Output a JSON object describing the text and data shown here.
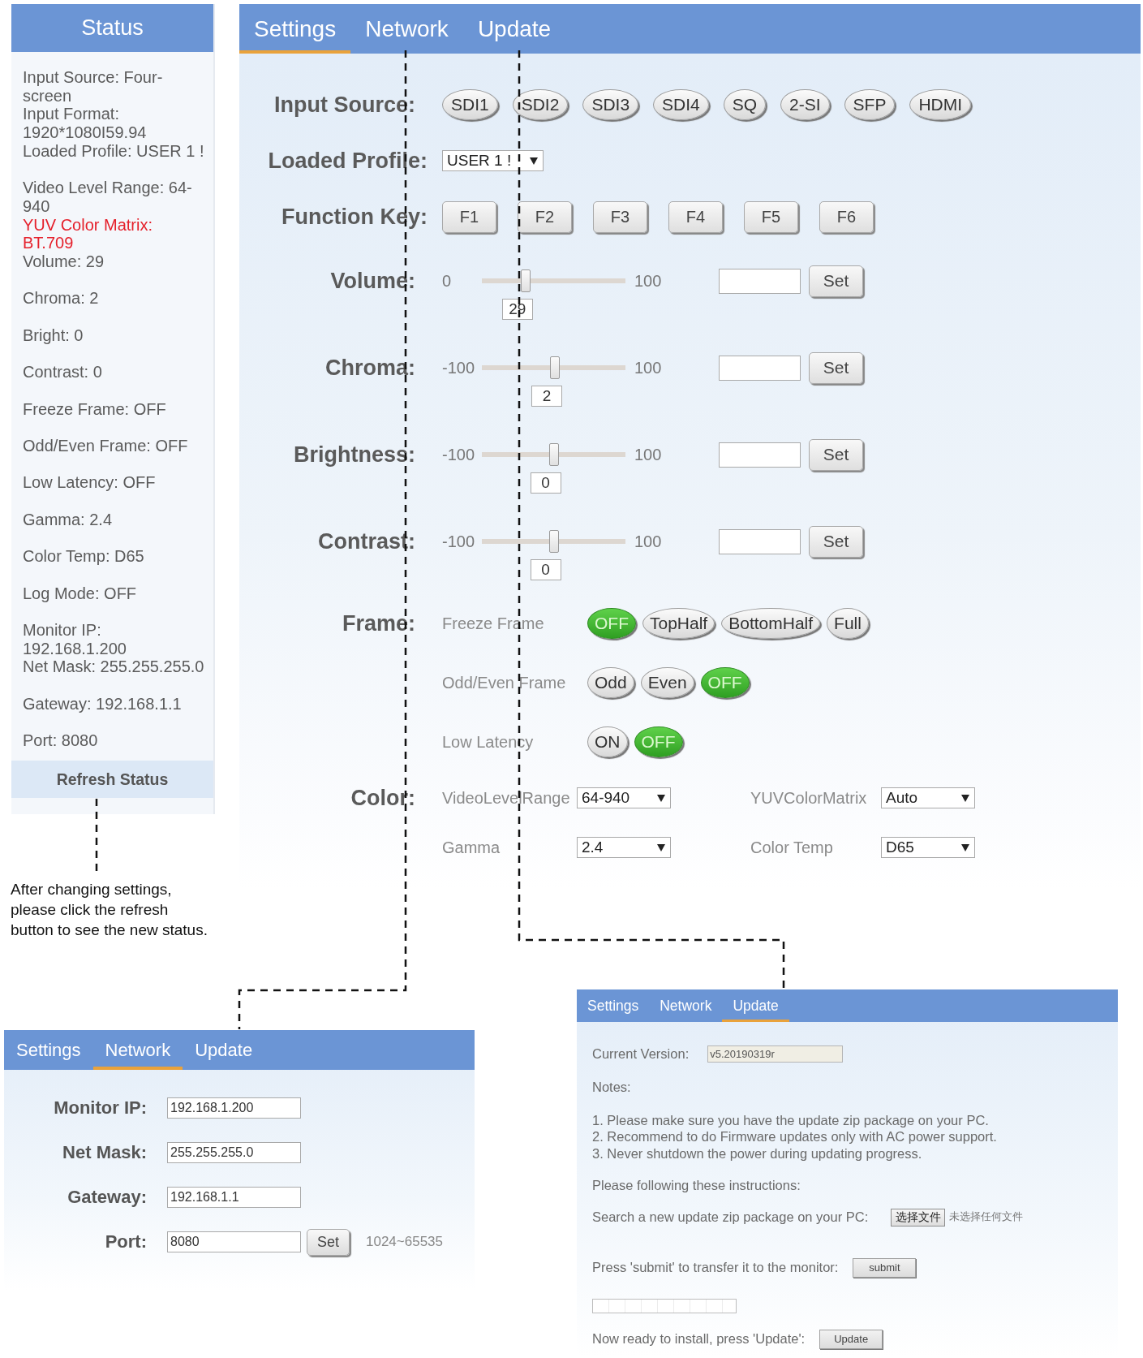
{
  "status_panel": {
    "title": "Status",
    "groups": [
      {
        "lines": [
          {
            "text": "Input Source: Four-screen",
            "highlighted": false
          },
          {
            "text": "Input Format: 1920*1080I59.94",
            "highlighted": false
          },
          {
            "text": "Loaded Profile: USER 1 !",
            "highlighted": false
          }
        ]
      },
      {
        "lines": [
          {
            "text": "Video Level Range: 64-940",
            "highlighted": false
          },
          {
            "text": "YUV Color Matrix: BT.709",
            "highlighted": true
          },
          {
            "text": "Volume: 29",
            "highlighted": false
          }
        ]
      },
      {
        "lines": [
          {
            "text": "Chroma: 2",
            "highlighted": false
          }
        ]
      },
      {
        "lines": [
          {
            "text": "Bright: 0",
            "highlighted": false
          }
        ]
      },
      {
        "lines": [
          {
            "text": "Contrast: 0",
            "highlighted": false
          }
        ]
      },
      {
        "lines": [
          {
            "text": "Freeze Frame: OFF",
            "highlighted": false
          }
        ]
      },
      {
        "lines": [
          {
            "text": "Odd/Even Frame: OFF",
            "highlighted": false
          }
        ]
      },
      {
        "lines": [
          {
            "text": "Low Latency: OFF",
            "highlighted": false
          }
        ]
      },
      {
        "lines": [
          {
            "text": "Gamma: 2.4",
            "highlighted": false
          }
        ]
      },
      {
        "lines": [
          {
            "text": "Color Temp: D65",
            "highlighted": false
          }
        ]
      },
      {
        "lines": [
          {
            "text": "Log Mode: OFF",
            "highlighted": false
          }
        ]
      },
      {
        "lines": [
          {
            "text": "Monitor IP: 192.168.1.200",
            "highlighted": false
          },
          {
            "text": "Net Mask: 255.255.255.0",
            "highlighted": false
          }
        ]
      },
      {
        "lines": [
          {
            "text": "Gateway: 192.168.1.1",
            "highlighted": false
          }
        ]
      },
      {
        "lines": [
          {
            "text": "Port: 8080",
            "highlighted": false
          }
        ]
      }
    ],
    "refresh_button": "Refresh Status"
  },
  "settings_panel": {
    "tabs": [
      {
        "label": "Settings",
        "selected": true
      },
      {
        "label": "Network",
        "selected": false
      },
      {
        "label": "Update",
        "selected": false
      }
    ],
    "rows": [
      {
        "kind": "pills",
        "label": "Input Source:",
        "options": [
          {
            "label": "SDI1",
            "selected": false
          },
          {
            "label": "SDI2",
            "selected": false
          },
          {
            "label": "SDI3",
            "selected": false
          },
          {
            "label": "SDI4",
            "selected": false
          },
          {
            "label": "SQ",
            "selected": false
          },
          {
            "label": "2-SI",
            "selected": false
          },
          {
            "label": "SFP",
            "selected": false
          },
          {
            "label": "HDMI",
            "selected": false
          }
        ]
      },
      {
        "kind": "select",
        "label": "Loaded Profile:",
        "value": "USER 1 !"
      },
      {
        "kind": "keys",
        "label": "Function Key:",
        "keys": [
          "F1",
          "F2",
          "F3",
          "F4",
          "F5",
          "F6"
        ]
      },
      {
        "kind": "slider",
        "label": "Volume:",
        "min": "0",
        "max": "100",
        "level": 0.29,
        "reading": "29",
        "button": "Set"
      },
      {
        "kind": "slider",
        "label": "Chroma:",
        "min": "-100",
        "max": "100",
        "level": 0.51,
        "reading": "2",
        "button": "Set"
      },
      {
        "kind": "slider",
        "label": "Brightness:",
        "min": "-100",
        "max": "100",
        "level": 0.5,
        "reading": "0",
        "button": "Set"
      },
      {
        "kind": "slider",
        "label": "Contrast:",
        "min": "-100",
        "max": "100",
        "level": 0.5,
        "reading": "0",
        "button": "Set"
      },
      {
        "kind": "toggles",
        "label": "Frame:",
        "groups": [
          {
            "label": "Freeze Frame",
            "options": [
              {
                "label": "OFF",
                "selected": true
              },
              {
                "label": "TopHalf",
                "selected": false
              },
              {
                "label": "BottomHalf",
                "selected": false
              },
              {
                "label": "Full",
                "selected": false
              }
            ]
          },
          {
            "label": "Odd/Even Frame",
            "options": [
              {
                "label": "Odd",
                "selected": false
              },
              {
                "label": "Even",
                "selected": false
              },
              {
                "label": "OFF",
                "selected": true
              }
            ]
          },
          {
            "label": "Low Latency",
            "options": [
              {
                "label": "ON",
                "selected": false
              },
              {
                "label": "OFF",
                "selected": true
              }
            ]
          }
        ]
      },
      {
        "kind": "selects",
        "label": "Color:",
        "fields": [
          {
            "label": "VideoLevelRange",
            "value": "64-940"
          },
          {
            "label": "YUVColorMatrix",
            "value": "Auto"
          },
          {
            "label": "Gamma",
            "value": "2.4"
          },
          {
            "label": "Color Temp",
            "value": "D65"
          }
        ]
      }
    ]
  },
  "note": "After changing settings, please click the refresh button to see the new status.",
  "network_panel": {
    "tabs": [
      {
        "label": "Settings",
        "selected": false
      },
      {
        "label": "Network",
        "selected": true
      },
      {
        "label": "Update",
        "selected": false
      }
    ],
    "fields": [
      {
        "label": "Monitor IP:",
        "value": "192.168.1.200"
      },
      {
        "label": "Net Mask:",
        "value": "255.255.255.0"
      },
      {
        "label": "Gateway:",
        "value": "192.168.1.1"
      },
      {
        "label": "Port:",
        "value": "8080",
        "button": "Set",
        "hint": "1024~65535"
      }
    ]
  },
  "update_panel": {
    "tabs": [
      {
        "label": "Settings",
        "selected": false
      },
      {
        "label": "Network",
        "selected": false
      },
      {
        "label": "Update",
        "selected": true
      }
    ],
    "version_label": "Current Version:",
    "version_value": "v5.20190319r",
    "notes_title": "Notes:",
    "notes": [
      "1. Please make sure you have the update zip package on your PC.",
      "2. Recommend to do Firmware updates only with AC power support.",
      "3. Never shutdown the power during updating progress."
    ],
    "instructions_title": "Please following these instructions:",
    "steps": [
      {
        "kind": "file",
        "text": "Search a new update zip package on your PC:",
        "button": "选择文件",
        "status": "未选择任何文件"
      },
      {
        "kind": "button",
        "text": "Press 'submit' to transfer it to the monitor:",
        "button": "submit"
      },
      {
        "kind": "progress",
        "level": 0
      },
      {
        "kind": "button",
        "text": "Now ready to install, press 'Update':",
        "button": "Update"
      }
    ]
  }
}
